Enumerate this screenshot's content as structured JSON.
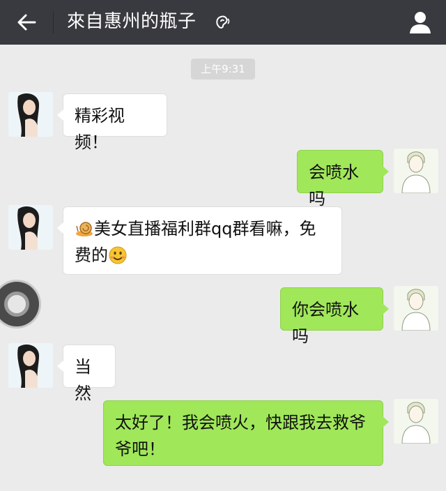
{
  "header": {
    "title": "來自惠州的瓶子"
  },
  "timestamp": "上午9:31",
  "messages": [
    {
      "side": "in",
      "text": "精彩视频！"
    },
    {
      "side": "out",
      "text": "会喷水吗"
    },
    {
      "side": "in",
      "text_line1": "美女直播福利群qq群看嘛，免",
      "text_line2": "费的"
    },
    {
      "side": "out",
      "text": "你会喷水吗"
    },
    {
      "side": "in",
      "text": "当然"
    },
    {
      "side": "out",
      "text_line1": "太好了！我会喷火，快跟我去救爷",
      "text_line2": "爷吧！"
    }
  ],
  "colors": {
    "topbar": "#393a3f",
    "background": "#ebebeb",
    "outgoing_bubble": "#a0e75a",
    "incoming_bubble": "#ffffff"
  }
}
